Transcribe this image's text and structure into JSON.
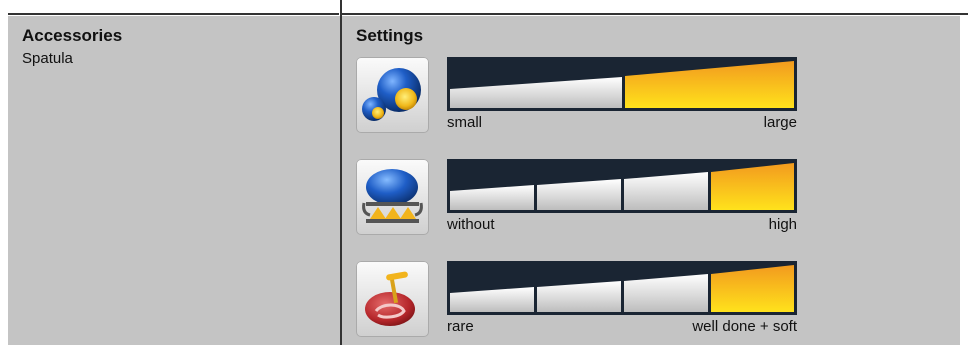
{
  "accessories": {
    "heading": "Accessories",
    "items": [
      "Spatula"
    ]
  },
  "settings": {
    "heading": "Settings",
    "rows": [
      {
        "icon": "cookie-size-icon",
        "min_label": "small",
        "max_label": "large",
        "steps": 2,
        "selected": 2,
        "mode": "continuous"
      },
      {
        "icon": "browning-level-icon",
        "min_label": "without",
        "max_label": "high",
        "steps": 4,
        "selected": 4,
        "mode": "segmented"
      },
      {
        "icon": "meat-doneness-icon",
        "min_label": "rare",
        "max_label": "well done + soft",
        "steps": 4,
        "selected": 4,
        "mode": "segmented"
      }
    ]
  },
  "colors": {
    "panel": "#c4c4c4",
    "track_dark": "#1a2533",
    "active_top": "#f29a1e",
    "active_bottom": "#ffe21c",
    "inactive_top": "#ffffff",
    "inactive_bottom": "#bfbfbf"
  }
}
